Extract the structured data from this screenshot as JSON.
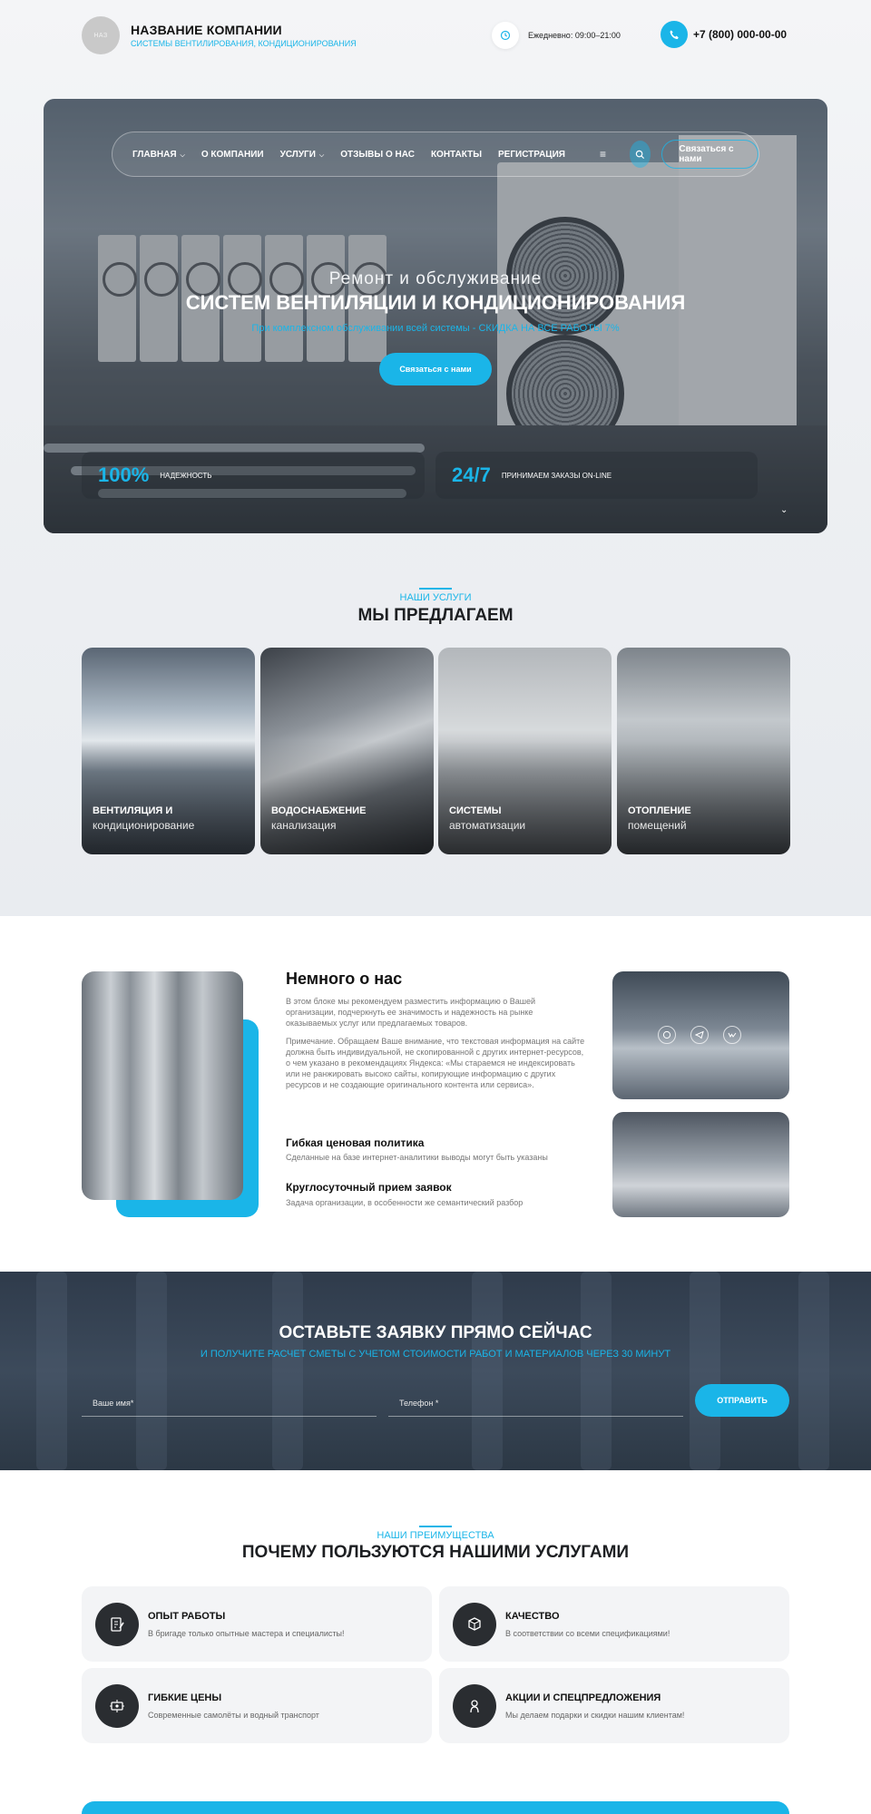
{
  "header": {
    "logo_text": "НАЗ",
    "company_name": "НАЗВАНИЕ КОМПАНИИ",
    "company_tagline": "СИСТЕМЫ ВЕНТИЛИРОВАНИЯ, КОНДИЦИОНИРОВАНИЯ",
    "hours": "Ежедневно: 09:00–21:00",
    "phone": "+7 (800) 000-00-00"
  },
  "nav": {
    "items": [
      {
        "label": "ГЛАВНАЯ",
        "dropdown": true
      },
      {
        "label": "О КОМПАНИИ",
        "dropdown": false
      },
      {
        "label": "УСЛУГИ",
        "dropdown": true
      },
      {
        "label": "ОТЗЫВЫ О НАС",
        "dropdown": false
      },
      {
        "label": "КОНТАКТЫ",
        "dropdown": false
      },
      {
        "label": "РЕГИСТРАЦИЯ",
        "dropdown": false
      }
    ],
    "cta_label": "Связаться с нами"
  },
  "hero": {
    "kicker": "Ремонт и обслуживание",
    "title": "СИСТЕМ ВЕНТИЛЯЦИИ И КОНДИЦИОНИРОВАНИЯ",
    "subtitle": "При комплексном обслуживании всей системы - СКИДКА НА ВСЕ РАБОТЫ 7%",
    "button": "Связаться с нами",
    "stats": [
      {
        "value": "100%",
        "label": "НАДЕЖНОСТЬ"
      },
      {
        "value": "24/7",
        "label": "ПРИНИМАЕМ ЗАКАЗЫ ON-LINE"
      }
    ]
  },
  "services": {
    "kicker": "НАШИ УСЛУГИ",
    "title": "МЫ ПРЕДЛАГАЕМ",
    "cards": [
      {
        "title": "ВЕНТИЛЯЦИЯ И",
        "subtitle": "кондиционирование"
      },
      {
        "title": "ВОДОСНАБЖЕНИЕ",
        "subtitle": "канализация"
      },
      {
        "title": "СИСТЕМЫ",
        "subtitle": "автоматизации"
      },
      {
        "title": "ОТОПЛЕНИЕ",
        "subtitle": "помещений"
      }
    ]
  },
  "about": {
    "title": "Немного о нас",
    "paragraph1": "В этом блоке мы рекомендуем разместить информацию о Вашей организации, подчеркнуть ее значимость и надежность на рынке оказываемых услуг или предлагаемых товаров.",
    "paragraph2": "Примечание. Обращаем Ваше внимание, что текстовая информация на сайте должна быть индивидуальной, не скопированной с других интернет-ресурсов, о чем указано в рекомендациях Яндекса: «Мы стараемся не индексировать или не ранжировать высоко сайты, копирующие информацию с других ресурсов и не создающие оригинального контента или сервиса».",
    "features": [
      {
        "title": "Гибкая ценовая политика",
        "desc": "Сделанные на базе интернет-аналитики выводы могут быть указаны"
      },
      {
        "title": "Круглосуточный прием заявок",
        "desc": "Задача организации, в особенности же семантический разбор"
      }
    ]
  },
  "request": {
    "title": "ОСТАВЬТЕ ЗАЯВКУ ПРЯМО СЕЙЧАС",
    "subtitle": "И ПОЛУЧИТЕ РАСЧЕТ СМЕТЫ С УЧЕТОМ СТОИМОСТИ РАБОТ И МАТЕРИАЛОВ ЧЕРЕЗ 30 МИНУТ",
    "name_placeholder": "Ваше имя*",
    "phone_placeholder": "Телефон *",
    "button": "ОТПРАВИТЬ"
  },
  "advantages": {
    "kicker": "НАШИ ПРЕИМУЩЕСТВА",
    "title": "ПОЧЕМУ ПОЛЬЗУЮТСЯ НАШИМИ УСЛУГАМИ",
    "items": [
      {
        "title": "ОПЫТ РАБОТЫ",
        "desc": "В бригаде только опытные мастера и специалисты!",
        "icon": "document-pen-icon"
      },
      {
        "title": "КАЧЕСТВО",
        "desc": "В соответствии со всеми спецификациями!",
        "icon": "box-icon"
      },
      {
        "title": "ГИБКИЕ ЦЕНЫ",
        "desc": "Современные самолёты и водный транспорт",
        "icon": "price-tag-icon"
      },
      {
        "title": "АКЦИИ И СПЕЦПРЕДЛОЖЕНИЯ",
        "desc": "Мы делаем подарки и скидки нашим клиентам!",
        "icon": "gift-hand-icon"
      }
    ]
  },
  "colors": {
    "accent": "#1ab5e8",
    "dark": "#1d1f22",
    "card_bg": "#f3f4f6"
  }
}
